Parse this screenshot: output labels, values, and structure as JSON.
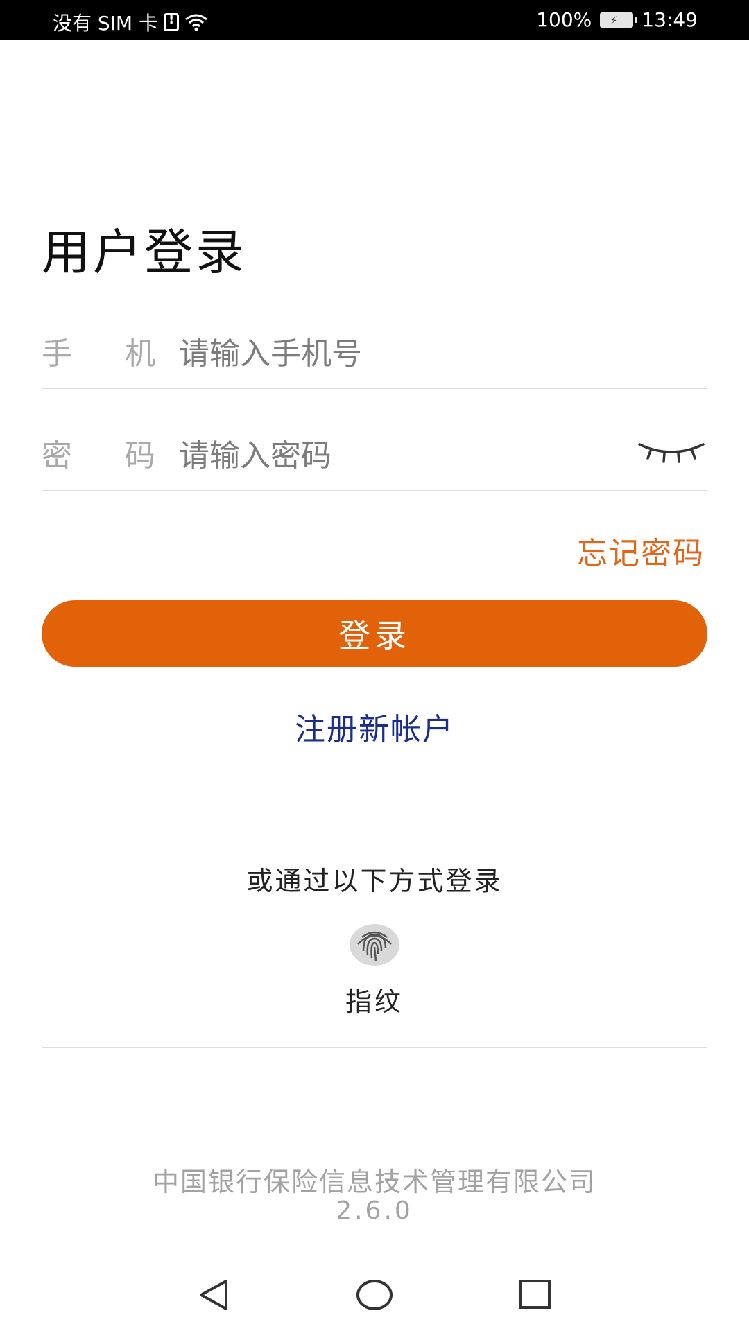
{
  "status_bar": {
    "carrier": "没有 SIM 卡",
    "battery": "100%",
    "time": "13:49"
  },
  "page": {
    "title": "用户登录"
  },
  "phone_field": {
    "label_1": "手",
    "label_2": "机",
    "placeholder": "请输入手机号"
  },
  "password_field": {
    "label_1": "密",
    "label_2": "码",
    "placeholder": "请输入密码"
  },
  "forgot_password": "忘记密码",
  "login_button": "登录",
  "register_link": "注册新帐户",
  "alt_login": {
    "title": "或通过以下方式登录",
    "fingerprint_label": "指纹"
  },
  "footer": {
    "company": "中国银行保险信息技术管理有限公司",
    "version": "2.6.0"
  },
  "colors": {
    "accent": "#e2620a",
    "forgot": "#e0661a",
    "register": "#1a2d8a"
  },
  "icons": {
    "wifi": "wifi-icon",
    "sim": "sim-alert-icon",
    "battery": "battery-charging-icon",
    "eye": "eye-closed-icon",
    "fingerprint": "fingerprint-icon",
    "back": "back-triangle-icon",
    "home": "home-circle-icon",
    "recent": "recent-square-icon"
  }
}
